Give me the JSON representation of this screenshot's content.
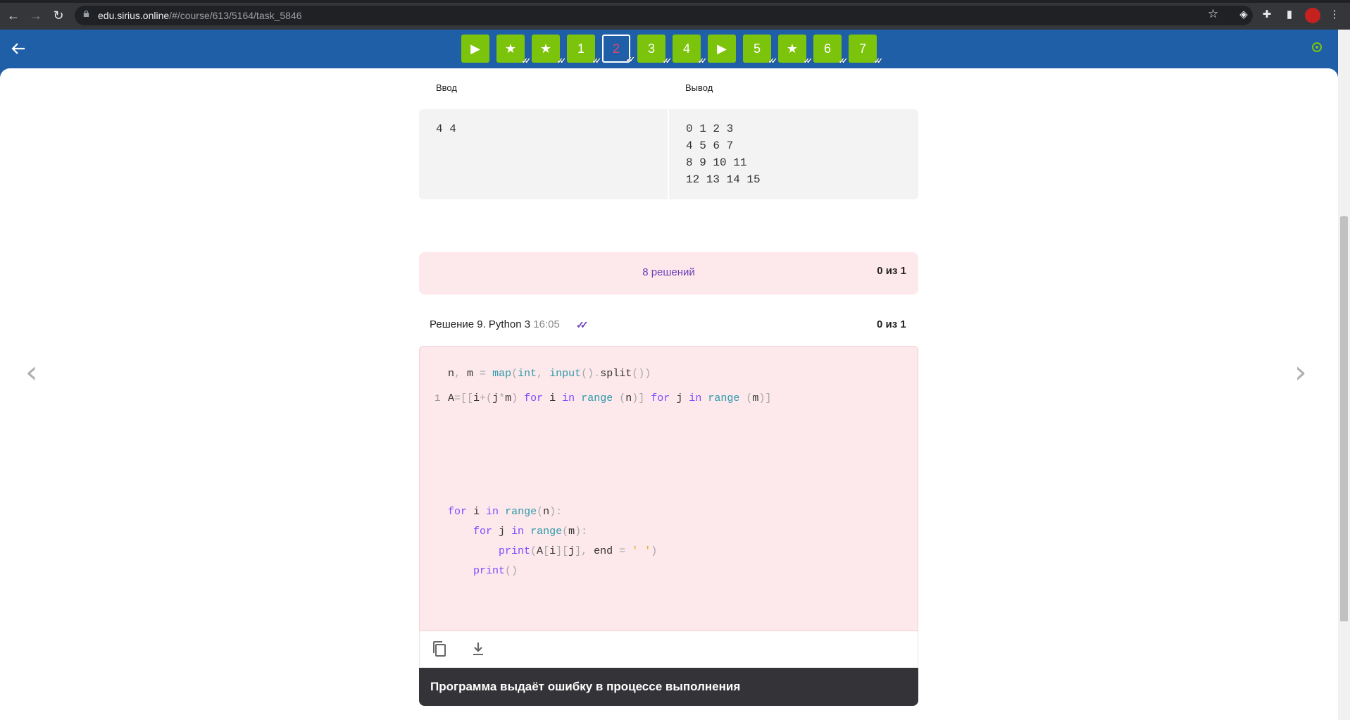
{
  "browser": {
    "url_host": "edu.sirius.online",
    "url_path": "/#/course/613/5164/task_5846",
    "back_icon": "←",
    "forward_icon": "→",
    "reload_icon": "↻",
    "bookmark_icon": "☆"
  },
  "tasks": [
    {
      "label": "▶",
      "kind": "video",
      "done": false
    },
    {
      "label": "★",
      "kind": "star",
      "done": true
    },
    {
      "label": "★",
      "kind": "star",
      "done": true
    },
    {
      "label": "1",
      "kind": "task",
      "done": true
    },
    {
      "label": "2",
      "kind": "task",
      "done": true,
      "active": true
    },
    {
      "label": "3",
      "kind": "task",
      "done": true
    },
    {
      "label": "4",
      "kind": "task",
      "done": true
    },
    {
      "label": "▶",
      "kind": "video",
      "done": false
    },
    {
      "label": "5",
      "kind": "task",
      "done": true
    },
    {
      "label": "★",
      "kind": "star",
      "done": true
    },
    {
      "label": "6",
      "kind": "task",
      "done": true
    },
    {
      "label": "7",
      "kind": "task",
      "done": true
    }
  ],
  "example": {
    "input_header": "Ввод",
    "output_header": "Вывод",
    "input": "4 4",
    "output": "0 1 2 3\n4 5 6 7\n8 9 10 11\n12 13 14 15"
  },
  "solutions": {
    "link_label": "8 решений",
    "score": "0 из 1"
  },
  "solution": {
    "title": "Решение 9. Python 3",
    "time": "16:05",
    "score": "0 из 1",
    "line_number": "1",
    "error": "Программа выдаёт ошибку в процессе выполнения"
  },
  "colors": {
    "header_blue": "#1e5fa8",
    "task_green": "#7cc30c",
    "error_pink": "#fde8ec",
    "accent_purple": "#6a3fb5"
  }
}
